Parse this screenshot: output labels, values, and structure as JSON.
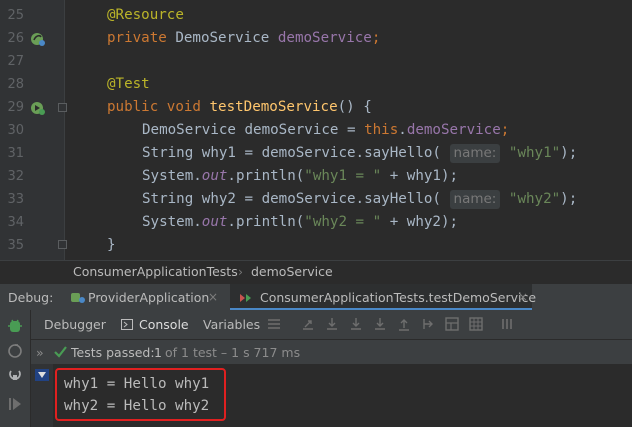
{
  "editor": {
    "lines": [
      {
        "n": "25"
      },
      {
        "n": "26"
      },
      {
        "n": "27"
      },
      {
        "n": "28"
      },
      {
        "n": "29"
      },
      {
        "n": "30"
      },
      {
        "n": "31"
      },
      {
        "n": "32"
      },
      {
        "n": "33"
      },
      {
        "n": "34"
      },
      {
        "n": "35"
      }
    ],
    "code": {
      "l25_ann": "@Resource",
      "l26_kw": "private",
      "l26_type": "DemoService",
      "l26_field": "demoService",
      "l26_semi": ";",
      "l28_ann": "@Test",
      "l29_kw1": "public",
      "l29_kw2": "void",
      "l29_method": "testDemoService",
      "l29_rest": "() {",
      "l30_type": "DemoService demoService = ",
      "l30_this": "this",
      "l30_dot": ".",
      "l30_field": "demoService",
      "l30_semi": ";",
      "l31_pre": "String why1 = demoService.sayHello(",
      "l31_hint": "name:",
      "l31_str": "\"why1\"",
      "l31_post": ");",
      "l32_pre": "System.",
      "l32_out": "out",
      "l32_mid": ".println(",
      "l32_str": "\"why1 = \"",
      "l32_post": " + why1);",
      "l33_pre": "String why2 = demoService.sayHello(",
      "l33_hint": "name:",
      "l33_str": "\"why2\"",
      "l33_post": ");",
      "l34_pre": "System.",
      "l34_out": "out",
      "l34_mid": ".println(",
      "l34_str": "\"why2 = \"",
      "l34_post": " + why2);",
      "l35": "}"
    }
  },
  "breadcrumb": {
    "class_name": "ConsumerApplicationTests",
    "separator": "›",
    "member": "demoService"
  },
  "debug": {
    "label": "Debug:",
    "tabs": [
      {
        "label": "ProviderApplication",
        "close": "×"
      },
      {
        "label": "ConsumerApplicationTests.testDemoService",
        "close": "×"
      }
    ]
  },
  "subtabs": {
    "debugger": "Debugger",
    "console": "Console",
    "variables": "Variables"
  },
  "tests": {
    "chevron": "»",
    "passed": "Tests passed:",
    "count": "1",
    "detail": "of 1 test – 1 s 717 ms"
  },
  "console": {
    "lines": [
      "why1 = Hello why1",
      "why2 = Hello why2"
    ]
  },
  "colors": {
    "accent": "#4a88c7",
    "pass": "#499c54",
    "highlight_box": "#e02020"
  }
}
